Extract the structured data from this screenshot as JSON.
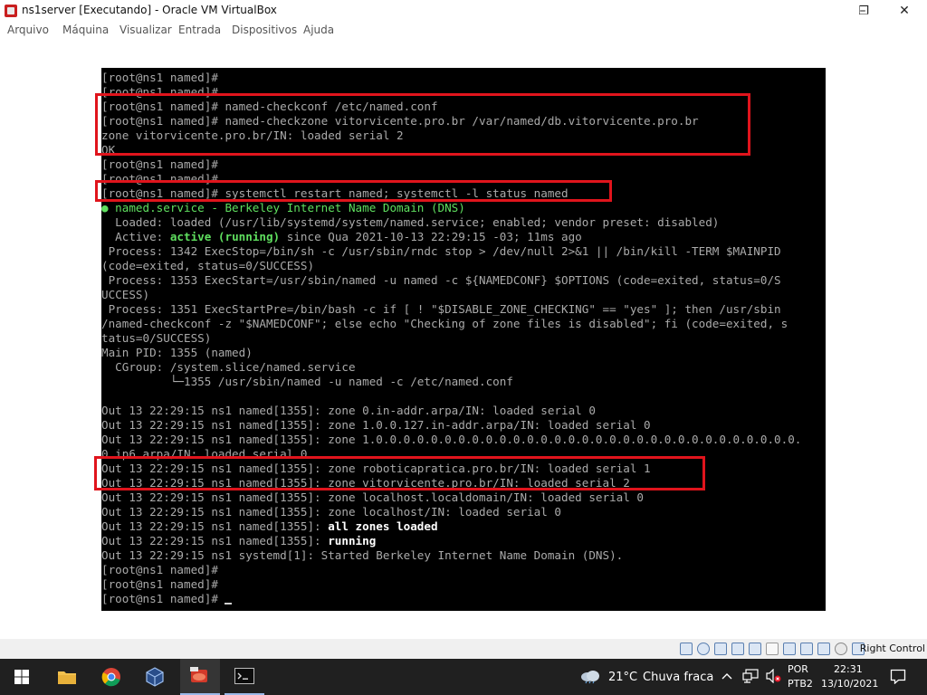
{
  "window": {
    "title": "ns1server [Executando] - Oracle VM VirtualBox",
    "controls": {
      "minimize": "–",
      "restore": "❐",
      "close": "✕"
    }
  },
  "menu": {
    "items": [
      "Arquivo",
      "Máquina",
      "Visualizar",
      "Entrada",
      "Dispositivos",
      "Ajuda"
    ]
  },
  "terminal": {
    "lines": [
      {
        "text": "[root@ns1 named]#"
      },
      {
        "text": "[root@ns1 named]#"
      },
      {
        "text": "[root@ns1 named]# named-checkconf /etc/named.conf"
      },
      {
        "text": "[root@ns1 named]# named-checkzone vitorvicente.pro.br /var/named/db.vitorvicente.pro.br"
      },
      {
        "text": "zone vitorvicente.pro.br/IN: loaded serial 2"
      },
      {
        "text": "OK"
      },
      {
        "text": "[root@ns1 named]#"
      },
      {
        "text": "[root@ns1 named]#"
      },
      {
        "text": "[root@ns1 named]# systemctl restart named; systemctl -l status named"
      },
      {
        "text": "● named.service - Berkeley Internet Name Domain (DNS)"
      },
      {
        "text": "  Loaded: loaded (/usr/lib/systemd/system/named.service; enabled; vendor preset: disabled)"
      },
      {
        "text": "  Active: ",
        "green": "active (running)",
        "rest": " since Qua 2021-10-13 22:29:15 -03; 11ms ago"
      },
      {
        "text": " Process: 1342 ExecStop=/bin/sh -c /usr/sbin/rndc stop > /dev/null 2>&1 || /bin/kill -TERM $MAINPID"
      },
      {
        "text": "(code=exited, status=0/SUCCESS)"
      },
      {
        "text": " Process: 1353 ExecStart=/usr/sbin/named -u named -c ${NAMEDCONF} $OPTIONS (code=exited, status=0/S"
      },
      {
        "text": "UCCESS)"
      },
      {
        "text": " Process: 1351 ExecStartPre=/bin/bash -c if [ ! \"$DISABLE_ZONE_CHECKING\" == \"yes\" ]; then /usr/sbin"
      },
      {
        "text": "/named-checkconf -z \"$NAMEDCONF\"; else echo \"Checking of zone files is disabled\"; fi (code=exited, s"
      },
      {
        "text": "tatus=0/SUCCESS)"
      },
      {
        "text": "Main PID: 1355 (named)"
      },
      {
        "text": "  CGroup: /system.slice/named.service"
      },
      {
        "text": "          └─1355 /usr/sbin/named -u named -c /etc/named.conf"
      },
      {
        "text": ""
      },
      {
        "text": "Out 13 22:29:15 ns1 named[1355]: zone 0.in-addr.arpa/IN: loaded serial 0"
      },
      {
        "text": "Out 13 22:29:15 ns1 named[1355]: zone 1.0.0.127.in-addr.arpa/IN: loaded serial 0"
      },
      {
        "text": "Out 13 22:29:15 ns1 named[1355]: zone 1.0.0.0.0.0.0.0.0.0.0.0.0.0.0.0.0.0.0.0.0.0.0.0.0.0.0.0.0.0.0.0."
      },
      {
        "text": "0.ip6.arpa/IN: loaded serial 0"
      },
      {
        "text": "Out 13 22:29:15 ns1 named[1355]: zone roboticapratica.pro.br/IN: loaded serial 1"
      },
      {
        "text": "Out 13 22:29:15 ns1 named[1355]: zone vitorvicente.pro.br/IN: loaded serial 2"
      },
      {
        "text": "Out 13 22:29:15 ns1 named[1355]: zone localhost.localdomain/IN: loaded serial 0"
      },
      {
        "text": "Out 13 22:29:15 ns1 named[1355]: zone localhost/IN: loaded serial 0"
      },
      {
        "text": "Out 13 22:29:15 ns1 named[1355]: ",
        "bold": "all zones loaded"
      },
      {
        "text": "Out 13 22:29:15 ns1 named[1355]: ",
        "bold": "running"
      },
      {
        "text": "Out 13 22:29:15 ns1 systemd[1]: Started Berkeley Internet Name Domain (DNS)."
      },
      {
        "text": "[root@ns1 named]#"
      },
      {
        "text": "[root@ns1 named]#"
      },
      {
        "text": "[root@ns1 named]# ",
        "cursor": true
      }
    ]
  },
  "statusbar": {
    "icons": [
      "hard-disk-icon",
      "optical-drive-icon",
      "audio-icon",
      "network-icon",
      "usb-icon",
      "shared-folders-icon",
      "display-icon",
      "screen-capture-icon",
      "video-capture-icon",
      "cpu-icon",
      "mouse-integration-icon",
      "host-key-icon"
    ],
    "host_key_label": "Right Control"
  },
  "taskbar": {
    "weather_temp": "21°C",
    "weather_desc": "Chuva fraca",
    "lang_top": "POR",
    "lang_bottom": "PTB2",
    "time": "22:31",
    "date": "13/10/2021"
  },
  "colors": {
    "highlight_box": "#e0141c",
    "terminal_bg": "#000000",
    "terminal_fg": "#aaaaaa",
    "terminal_green": "#5fdf5f",
    "taskbar_bg": "#202020"
  }
}
